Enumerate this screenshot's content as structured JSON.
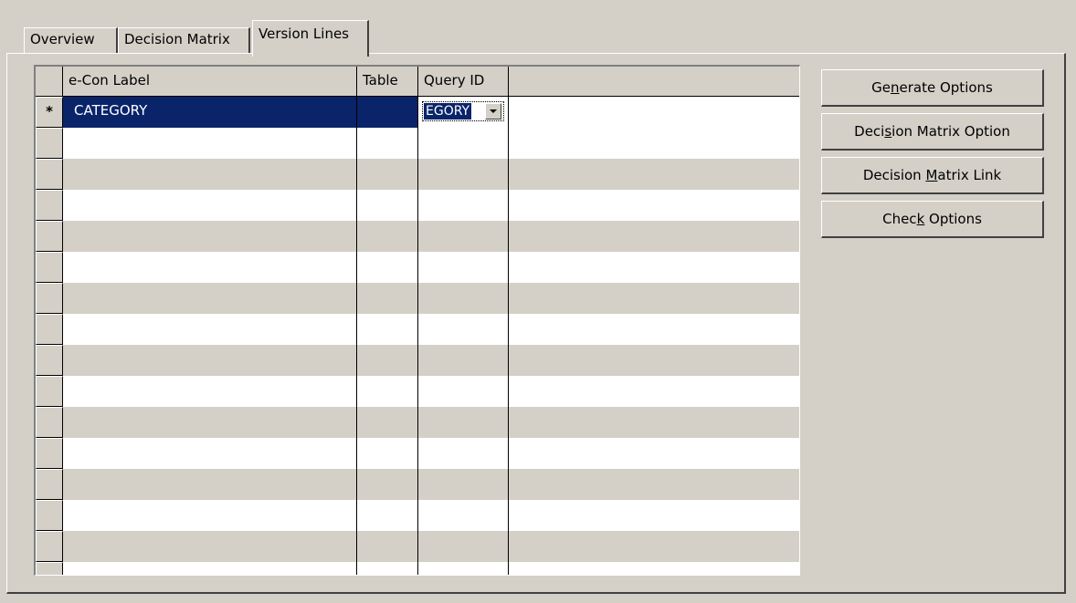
{
  "tabs": [
    {
      "label": "Overview"
    },
    {
      "label": "Decision Matrix"
    },
    {
      "label": "Version Lines",
      "active": true
    }
  ],
  "grid": {
    "columns": [
      "e-Con Label",
      "Table",
      "Query ID",
      ""
    ],
    "new_row_marker": "*",
    "rows": [
      {
        "label": "CATEGORY",
        "table": "",
        "query_id": "EGORY"
      }
    ]
  },
  "buttons": {
    "generate_pre": "Ge",
    "generate_key": "n",
    "generate_post": "erate Options",
    "dm_option_pre": "Deci",
    "dm_option_key": "s",
    "dm_option_post": "ion Matrix Option",
    "dm_link_pre": "Decision ",
    "dm_link_key": "M",
    "dm_link_post": "atrix Link",
    "check_pre": "Chec",
    "check_key": "k",
    "check_post": " Options"
  },
  "colors": {
    "face": "#d4d0c8",
    "selection": "#0a246a",
    "row_alt": "#d4d0c8"
  }
}
